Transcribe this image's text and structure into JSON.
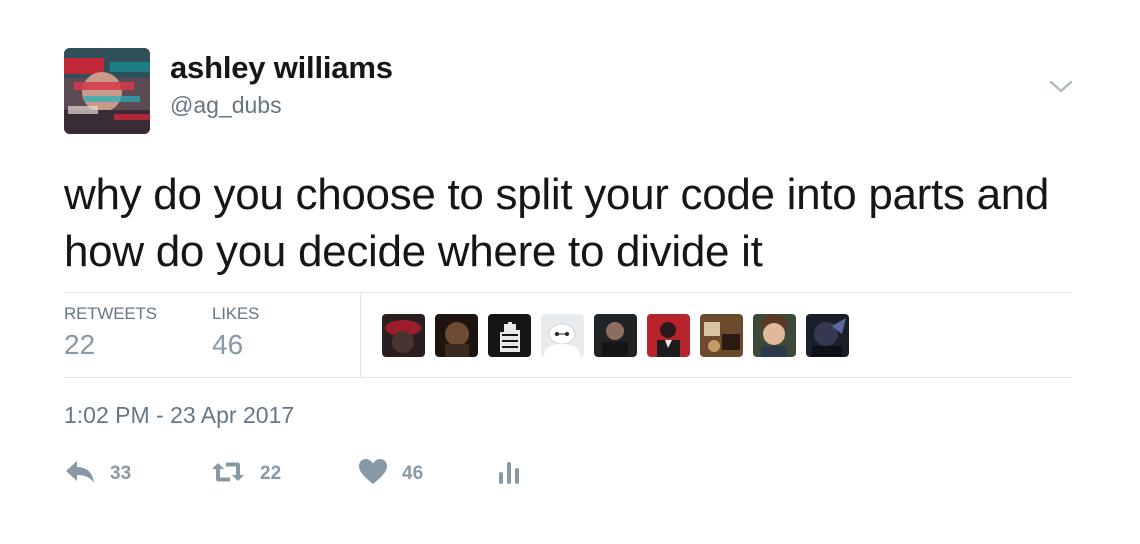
{
  "author": {
    "display_name": "ashley williams",
    "handle": "@ag_dubs",
    "avatar_icon": "profile-photo"
  },
  "tweet": {
    "text": "why do you choose to split your code into parts and how do you decide where to divide it",
    "timestamp": "1:02 PM - 23 Apr 2017"
  },
  "stats": {
    "retweets_label": "RETWEETS",
    "retweets_value": "22",
    "likes_label": "LIKES",
    "likes_value": "46"
  },
  "likers": [
    {
      "name": "liker-1"
    },
    {
      "name": "liker-2"
    },
    {
      "name": "liker-3"
    },
    {
      "name": "liker-4"
    },
    {
      "name": "liker-5"
    },
    {
      "name": "liker-6"
    },
    {
      "name": "liker-7"
    },
    {
      "name": "liker-8"
    },
    {
      "name": "liker-9"
    }
  ],
  "actions": {
    "reply_count": "33",
    "retweet_count": "22",
    "like_count": "46"
  },
  "colors": {
    "text_primary": "#14171a",
    "text_secondary": "#657786",
    "icon_gray": "#8899a6",
    "divider": "#e1e8ed"
  }
}
